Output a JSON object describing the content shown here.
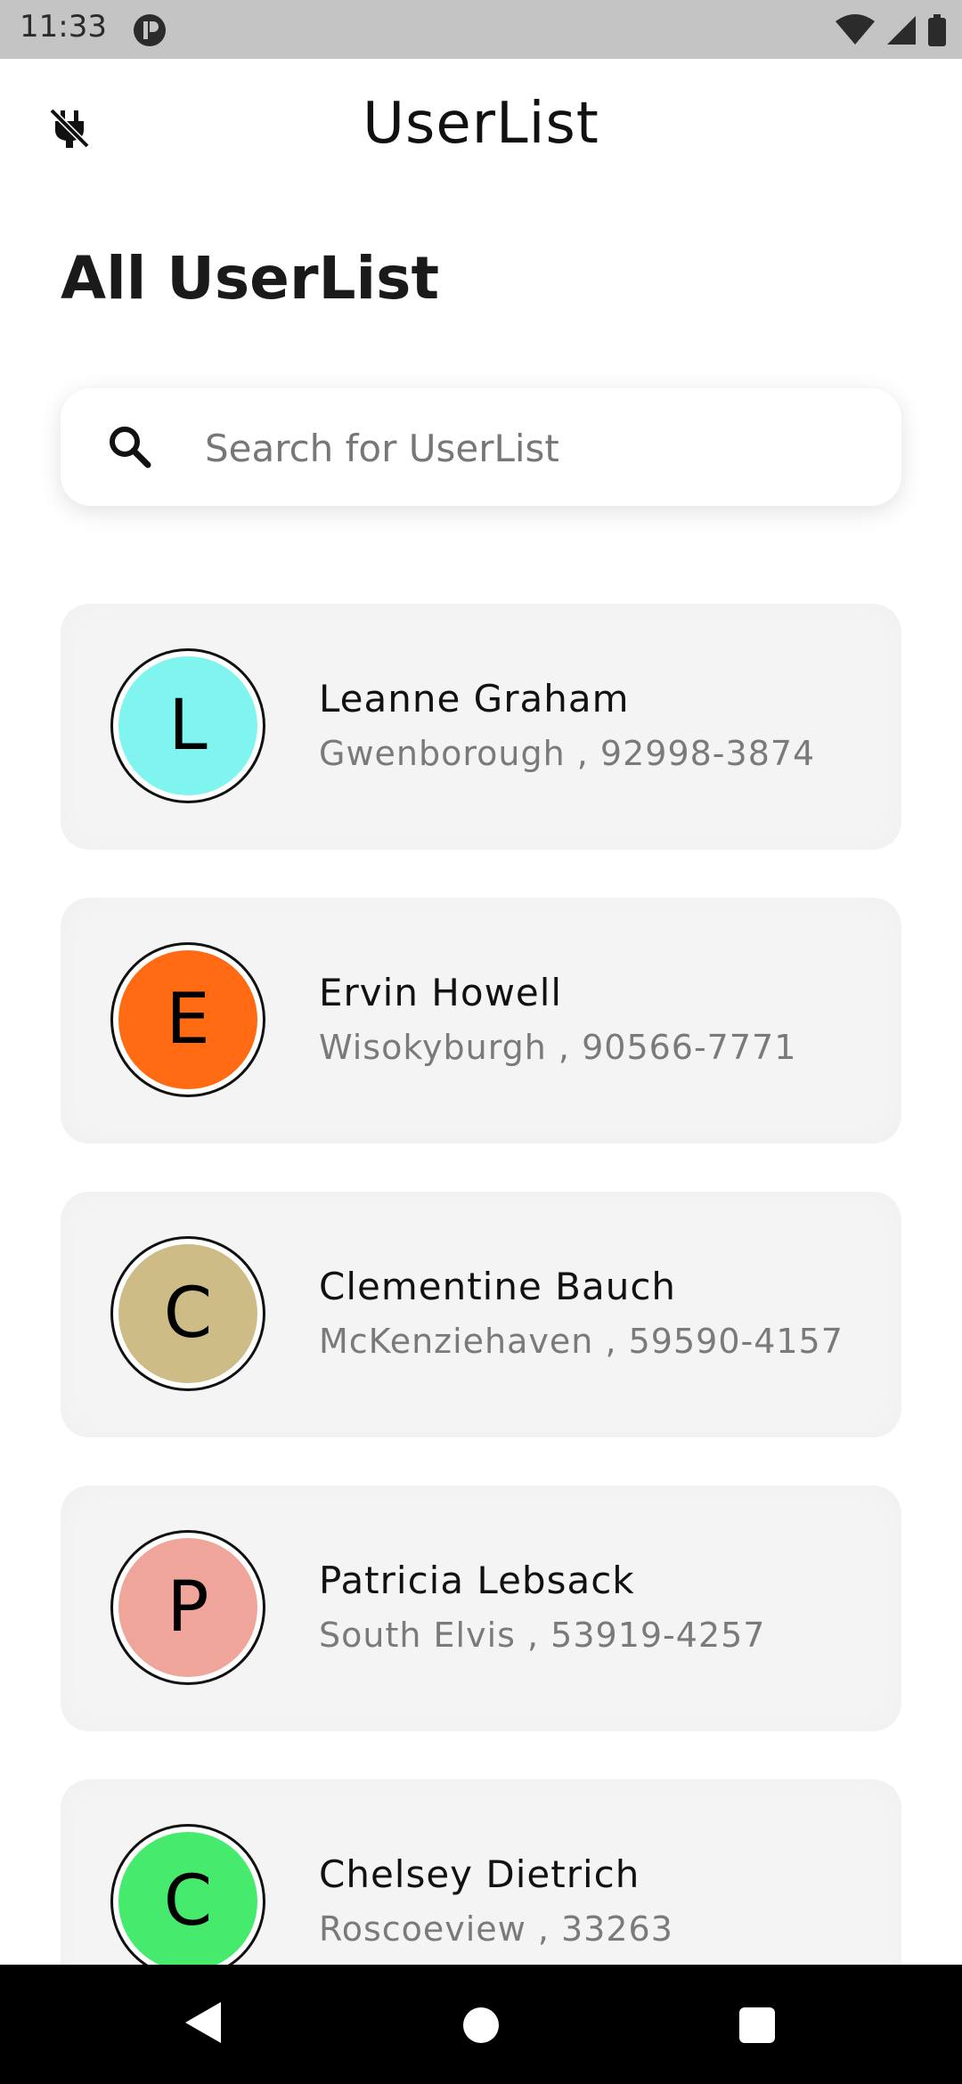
{
  "status_bar": {
    "time": "11:33"
  },
  "app_bar": {
    "title": "UserList",
    "leading_icon": "plug-off-icon"
  },
  "section": {
    "title": "All UserList"
  },
  "search": {
    "placeholder": "Search for UserList",
    "value": ""
  },
  "users": [
    {
      "initial": "L",
      "name": "Leanne Graham",
      "subtitle": "Gwenborough , 92998-3874",
      "color": "#80F5EF"
    },
    {
      "initial": "E",
      "name": "Ervin Howell",
      "subtitle": "Wisokyburgh , 90566-7771",
      "color": "#FF6A13"
    },
    {
      "initial": "C",
      "name": "Clementine Bauch",
      "subtitle": "McKenziehaven , 59590-4157",
      "color": "#CDBC86"
    },
    {
      "initial": "P",
      "name": "Patricia Lebsack",
      "subtitle": "South Elvis , 53919-4257",
      "color": "#F0A59A"
    },
    {
      "initial": "C",
      "name": "Chelsey Dietrich",
      "subtitle": "Roscoeview , 33263",
      "color": "#46EB6E"
    }
  ],
  "colors": {
    "status_bar": "#C4C4C4",
    "card": "#F4F4F4",
    "nav_bar": "#000000"
  }
}
